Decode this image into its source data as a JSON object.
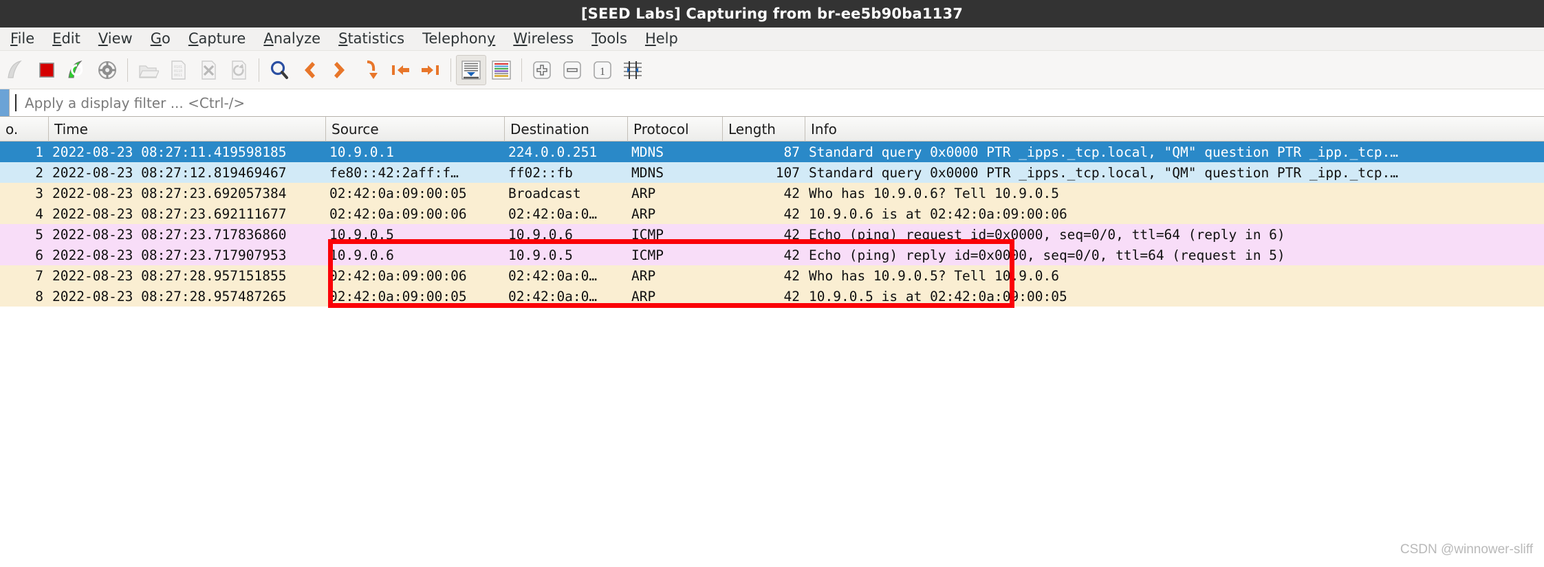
{
  "window": {
    "title": "[SEED Labs] Capturing from br-ee5b90ba1137",
    "titlebar_bg": "#333333"
  },
  "menu": {
    "items": [
      {
        "label": "File",
        "mnemonic": "F"
      },
      {
        "label": "Edit",
        "mnemonic": "E"
      },
      {
        "label": "View",
        "mnemonic": "V"
      },
      {
        "label": "Go",
        "mnemonic": "G"
      },
      {
        "label": "Capture",
        "mnemonic": "C"
      },
      {
        "label": "Analyze",
        "mnemonic": "A"
      },
      {
        "label": "Statistics",
        "mnemonic": "S"
      },
      {
        "label": "Telephony",
        "mnemonic": "y"
      },
      {
        "label": "Wireless",
        "mnemonic": "W"
      },
      {
        "label": "Tools",
        "mnemonic": "T"
      },
      {
        "label": "Help",
        "mnemonic": "H"
      }
    ]
  },
  "toolbar": {
    "buttons": [
      {
        "name": "start-capture-icon",
        "title": "Start capturing packets",
        "state": "disabled"
      },
      {
        "name": "stop-capture-icon",
        "title": "Stop capturing packets",
        "state": "enabled"
      },
      {
        "name": "restart-capture-icon",
        "title": "Restart current capture",
        "state": "enabled"
      },
      {
        "name": "capture-options-icon",
        "title": "Capture options",
        "state": "enabled"
      },
      {
        "name": "open-file-icon",
        "title": "Open a capture file",
        "state": "disabled"
      },
      {
        "name": "save-file-icon",
        "title": "Save this capture file",
        "state": "disabled"
      },
      {
        "name": "close-file-icon",
        "title": "Close this capture file",
        "state": "disabled"
      },
      {
        "name": "reload-file-icon",
        "title": "Reload this file",
        "state": "disabled"
      },
      {
        "name": "find-packet-icon",
        "title": "Find a packet",
        "state": "enabled"
      },
      {
        "name": "go-back-icon",
        "title": "Go back in packet history",
        "state": "enabled"
      },
      {
        "name": "go-forward-icon",
        "title": "Go forward in packet history",
        "state": "enabled"
      },
      {
        "name": "go-to-packet-icon",
        "title": "Go to the packet",
        "state": "enabled"
      },
      {
        "name": "go-to-first-packet-icon",
        "title": "Go to the first packet",
        "state": "enabled"
      },
      {
        "name": "go-to-last-packet-icon",
        "title": "Go to the last packet",
        "state": "enabled"
      },
      {
        "name": "auto-scroll-icon",
        "title": "Auto scroll in live capture",
        "state": "active"
      },
      {
        "name": "colorize-packets-icon",
        "title": "Colorize packet list",
        "state": "enabled"
      },
      {
        "name": "zoom-in-icon",
        "title": "Zoom in",
        "state": "enabled"
      },
      {
        "name": "zoom-out-icon",
        "title": "Zoom out",
        "state": "enabled"
      },
      {
        "name": "zoom-reset-icon",
        "title": "Normal size",
        "state": "enabled"
      },
      {
        "name": "resize-columns-icon",
        "title": "Resize columns",
        "state": "enabled"
      }
    ]
  },
  "filter": {
    "placeholder": "Apply a display filter ... <Ctrl-/>",
    "value": "",
    "flag_color": "#6ba3d6"
  },
  "packet_list": {
    "columns": [
      {
        "key": "no",
        "label": "o."
      },
      {
        "key": "time",
        "label": "Time"
      },
      {
        "key": "src",
        "label": "Source"
      },
      {
        "key": "dst",
        "label": "Destination"
      },
      {
        "key": "proto",
        "label": "Protocol"
      },
      {
        "key": "len",
        "label": "Length"
      },
      {
        "key": "info",
        "label": "Info"
      }
    ],
    "rows": [
      {
        "no": "1",
        "time": "2022-08-23 08:27:11.419598185",
        "src": "10.9.0.1",
        "dst": "224.0.0.251",
        "proto": "MDNS",
        "len": "87",
        "info": "Standard query 0x0000 PTR _ipps._tcp.local, \"QM\" question PTR _ipp._tcp.…",
        "style": "sel",
        "selected": true
      },
      {
        "no": "2",
        "time": "2022-08-23 08:27:12.819469467",
        "src": "fe80::42:2aff:f…",
        "dst": "ff02::fb",
        "proto": "MDNS",
        "len": "107",
        "info": "Standard query 0x0000 PTR _ipps._tcp.local, \"QM\" question PTR _ipp._tcp.…",
        "style": "mdns",
        "selected": false
      },
      {
        "no": "3",
        "time": "2022-08-23 08:27:23.692057384",
        "src": "02:42:0a:09:00:05",
        "dst": "Broadcast",
        "proto": "ARP",
        "len": "42",
        "info": "Who has 10.9.0.6? Tell 10.9.0.5",
        "style": "arp",
        "selected": false
      },
      {
        "no": "4",
        "time": "2022-08-23 08:27:23.692111677",
        "src": "02:42:0a:09:00:06",
        "dst": "02:42:0a:0…",
        "proto": "ARP",
        "len": "42",
        "info": "10.9.0.6 is at 02:42:0a:09:00:06",
        "style": "arp",
        "selected": false
      },
      {
        "no": "5",
        "time": "2022-08-23 08:27:23.717836860",
        "src": "10.9.0.5",
        "dst": "10.9.0.6",
        "proto": "ICMP",
        "len": "42",
        "info": "Echo (ping) request  id=0x0000, seq=0/0, ttl=64 (reply in 6)",
        "style": "icmp",
        "selected": false
      },
      {
        "no": "6",
        "time": "2022-08-23 08:27:23.717907953",
        "src": "10.9.0.6",
        "dst": "10.9.0.5",
        "proto": "ICMP",
        "len": "42",
        "info": "Echo (ping) reply    id=0x0000, seq=0/0, ttl=64 (request in 5)",
        "style": "icmp",
        "selected": false
      },
      {
        "no": "7",
        "time": "2022-08-23 08:27:28.957151855",
        "src": "02:42:0a:09:00:06",
        "dst": "02:42:0a:0…",
        "proto": "ARP",
        "len": "42",
        "info": "Who has 10.9.0.5? Tell 10.9.0.6",
        "style": "arp",
        "selected": false
      },
      {
        "no": "8",
        "time": "2022-08-23 08:27:28.957487265",
        "src": "02:42:0a:09:00:05",
        "dst": "02:42:0a:0…",
        "proto": "ARP",
        "len": "42",
        "info": "10.9.0.5 is at 02:42:0a:09:00:05",
        "style": "arp",
        "selected": false
      }
    ]
  },
  "annotation": {
    "highlight_color": "#fb0007",
    "note": "red rectangle around ICMP echo request/reply packets"
  },
  "watermark": {
    "text": "CSDN @winnower-sliff"
  },
  "colors": {
    "mdns_row": "#d2eaf7",
    "arp_row": "#faeed2",
    "icmp_row": "#f8ddf8",
    "selected_row": "#2a89c8",
    "titlebar": "#333333",
    "toolbar": "#f7f6f5"
  }
}
